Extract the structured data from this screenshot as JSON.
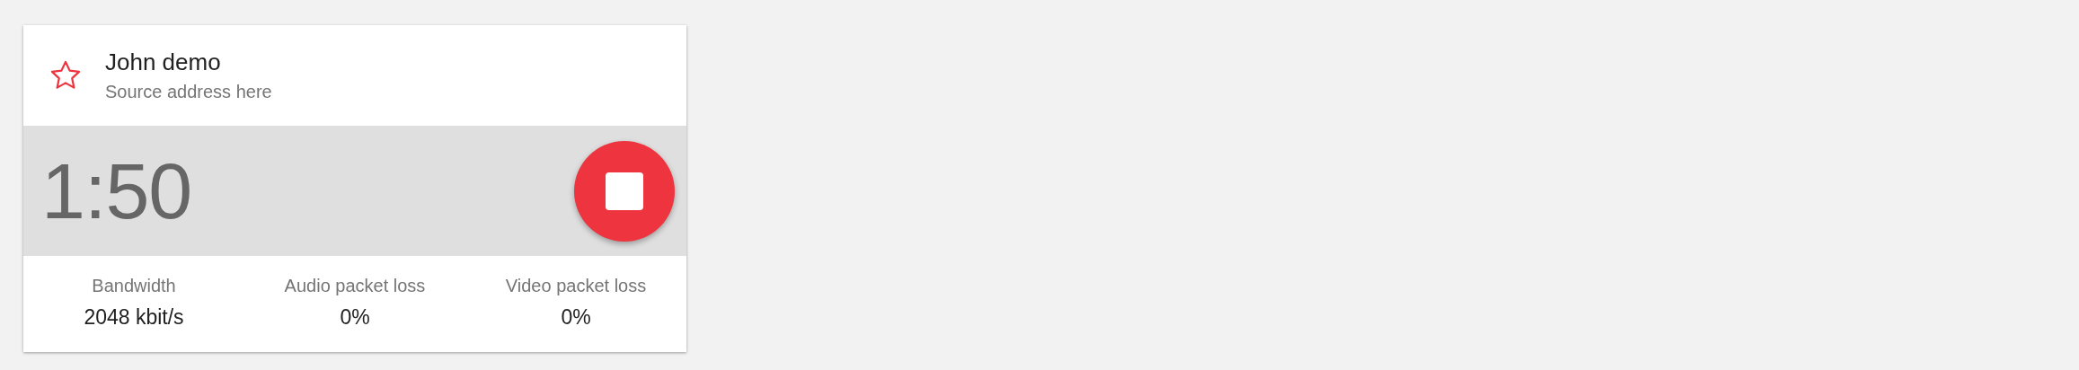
{
  "card": {
    "title": "John demo",
    "subtitle": "Source address here",
    "favorite": false,
    "timer": "1:50",
    "stats": [
      {
        "label": "Bandwidth",
        "value": "2048 kbit/s"
      },
      {
        "label": "Audio packet loss",
        "value": "0%"
      },
      {
        "label": "Video packet loss",
        "value": "0%"
      }
    ]
  }
}
